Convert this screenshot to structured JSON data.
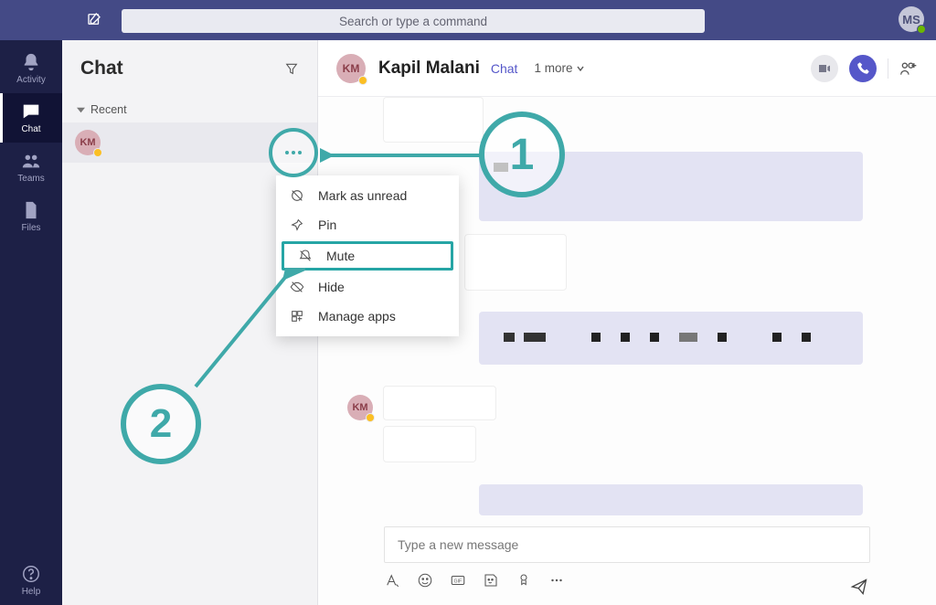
{
  "titlebar": {
    "search_placeholder": "Search or type a command",
    "user_initials": "MS"
  },
  "rail": {
    "activity": "Activity",
    "chat": "Chat",
    "teams": "Teams",
    "files": "Files",
    "help": "Help"
  },
  "chat_panel": {
    "title": "Chat",
    "recent": "Recent",
    "items": [
      {
        "initials": "KM"
      }
    ]
  },
  "conversation": {
    "avatar_initials": "KM",
    "name": "Kapil Malani",
    "tab": "Chat",
    "more": "1 more",
    "bubble_avatar": "KM",
    "compose_placeholder": "Type a new message"
  },
  "context_menu": {
    "items": [
      {
        "icon": "mark-unread-icon",
        "label": "Mark as unread"
      },
      {
        "icon": "pin-icon",
        "label": "Pin"
      },
      {
        "icon": "mute-icon",
        "label": "Mute",
        "highlight": true
      },
      {
        "icon": "hide-icon",
        "label": "Hide"
      },
      {
        "icon": "manage-apps-icon",
        "label": "Manage apps"
      }
    ]
  },
  "annotations": {
    "one": "1",
    "two": "2"
  },
  "colors": {
    "titlebar_bg": "#444a86",
    "rail_bg": "#1d2046",
    "accent": "#5557c9",
    "anno": "#3fa9a9"
  }
}
